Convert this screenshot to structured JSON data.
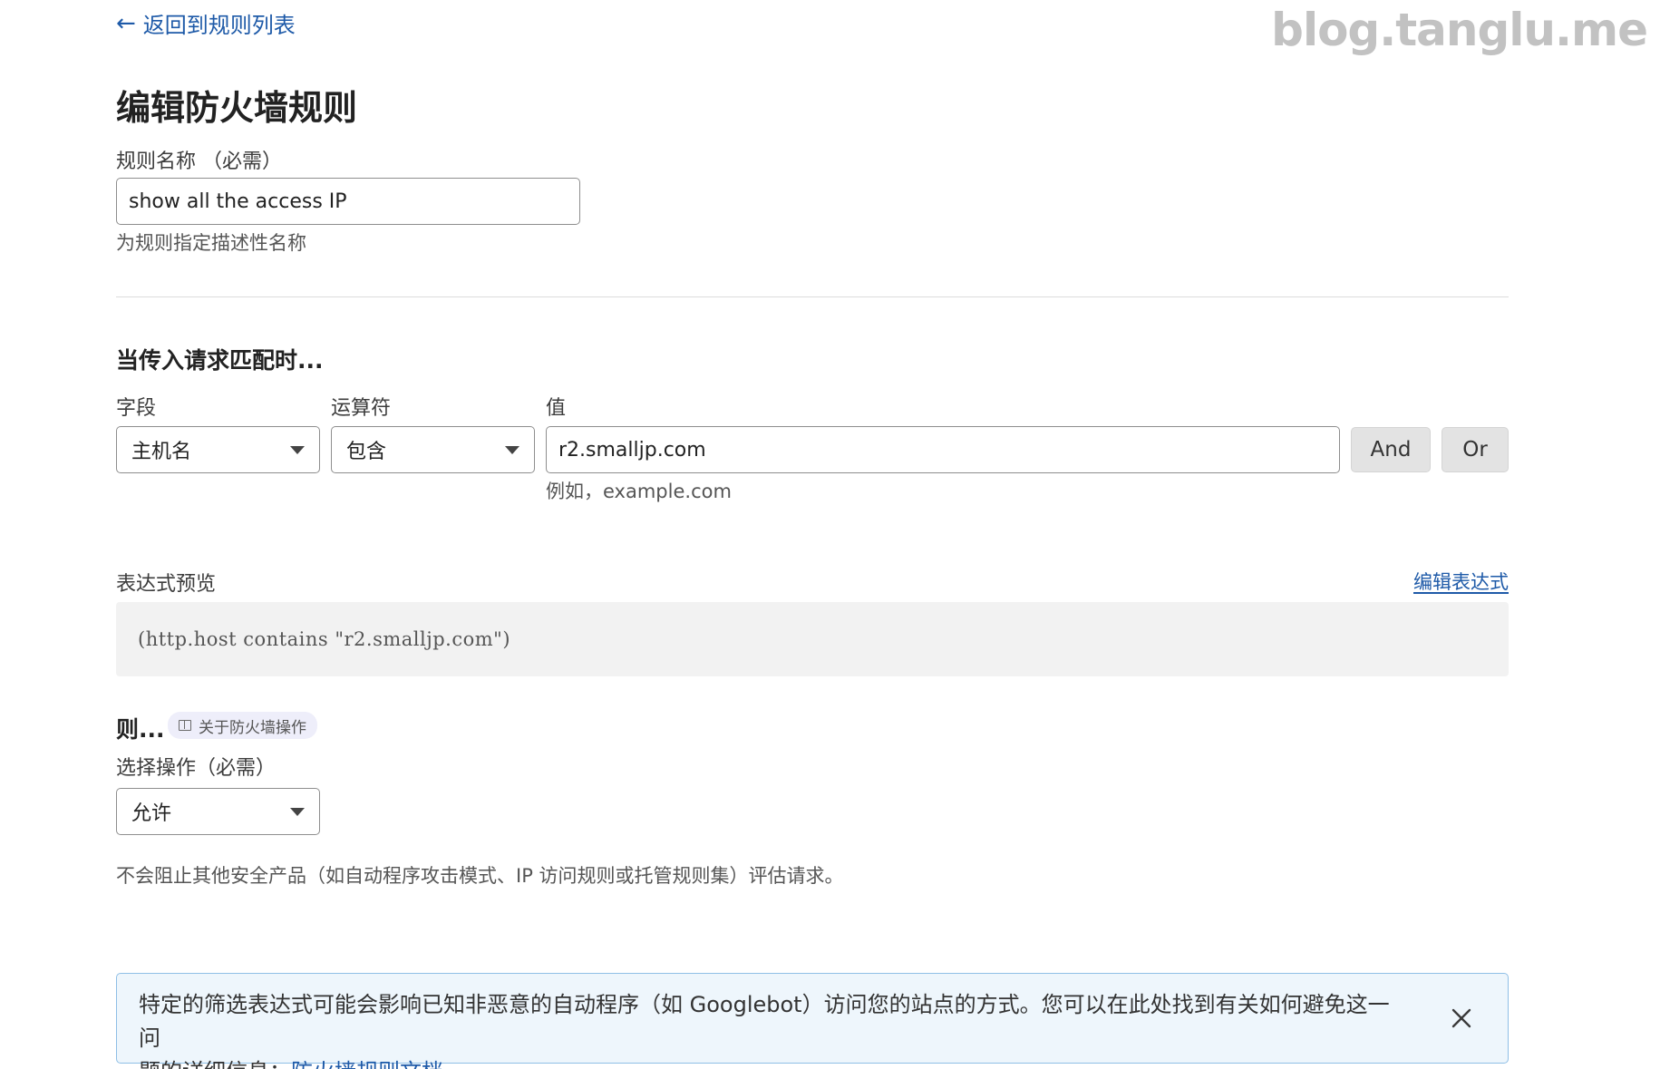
{
  "watermark": "blog.tanglu.me",
  "nav": {
    "back_arrow": "←",
    "back_label": "返回到规则列表"
  },
  "page_title": "编辑防火墙规则",
  "rule_name": {
    "label": "规则名称 （必需）",
    "value": "show all the access IP",
    "help": "为规则指定描述性名称"
  },
  "match_section": {
    "title": "当传入请求匹配时...",
    "field_label": "字段",
    "operator_label": "运算符",
    "value_label": "值",
    "field_value": "主机名",
    "operator_value": "包含",
    "value_value": "r2.smalljp.com",
    "value_help": "例如，example.com",
    "and_label": "And",
    "or_label": "Or"
  },
  "expression": {
    "label": "表达式预览",
    "edit_link": "编辑表达式",
    "preview": "(http.host contains \"r2.smalljp.com\")"
  },
  "action_section": {
    "title": "则...",
    "badge_label": "关于防火墙操作",
    "select_label": "选择操作（必需）",
    "select_value": "允许",
    "description": "不会阻止其他安全产品（如自动程序攻击模式、IP 访问规则或托管规则集）评估请求。"
  },
  "alert": {
    "text_line1": "特定的筛选表达式可能会影响已知非恶意的自动程序（如 Googlebot）访问您的站点的方式。您可以在此处找到有关如何避免这一问",
    "text_line2_prefix": "题的详细信息：",
    "link_label": "防火墙规则文档",
    "text_suffix": "。"
  },
  "colors": {
    "link": "#1e5aa8",
    "alert_bg": "#eef6fc",
    "alert_border": "#8fbfe6"
  }
}
